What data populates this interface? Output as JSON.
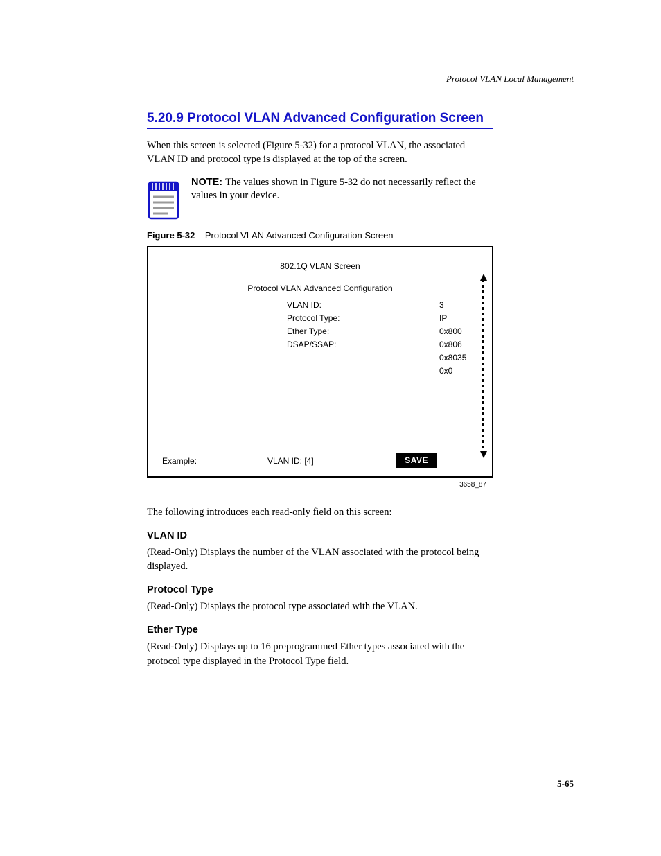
{
  "header": "Protocol VLAN Local Management",
  "page_number": "5-65",
  "section_title": "5.20.9  Protocol VLAN Advanced Configuration Screen",
  "intro_paragraph": "When this screen is selected (Figure 5-32) for a protocol VLAN, the associated VLAN ID and protocol type is displayed at the top of the screen.",
  "note": {
    "head": "NOTE:",
    "body": "The values shown in Figure 5-32 do not necessarily reflect the values in your device."
  },
  "figure": {
    "label": "Figure 5-32",
    "caption": "Protocol VLAN Advanced Configuration Screen",
    "panel_title": "802.1Q VLAN Screen",
    "mid_title": "Protocol VLAN Advanced Configuration",
    "rows": [
      {
        "k": "VLAN ID:",
        "v": "3"
      },
      {
        "k": "Protocol Type:",
        "v": "IP"
      },
      {
        "k": "Ether Type:",
        "v": "0x800"
      },
      {
        "k": "DSAP/SSAP:",
        "v": "0x806"
      },
      {
        "k": "",
        "v": "0x8035"
      },
      {
        "k": "",
        "v": "0x0"
      }
    ],
    "example_label": "Example:",
    "vlan_id_label": "VLAN ID:   [4]",
    "button": "SAVE",
    "ref": "3658_87"
  },
  "post_fig_text": "The following introduces each read-only field on this screen:",
  "fields": [
    {
      "title": "VLAN ID",
      "desc": "(Read-Only) Displays the number of the VLAN associated with the protocol being displayed."
    },
    {
      "title": "Protocol Type",
      "desc": "(Read-Only) Displays the protocol type associated with the VLAN."
    },
    {
      "title": "Ether Type",
      "desc": "(Read-Only) Displays up to 16 preprogrammed Ether types associated with the protocol type displayed in the Protocol Type field."
    }
  ]
}
